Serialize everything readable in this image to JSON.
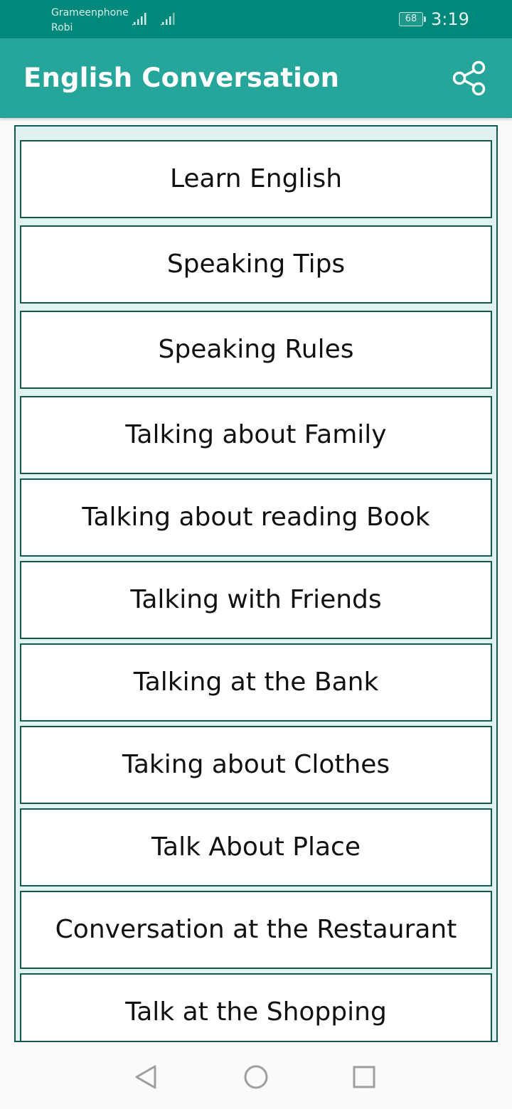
{
  "status_bar": {
    "carrier_1": "Grameenphone",
    "carrier_2": "Robi",
    "battery": "68",
    "time": "3:19"
  },
  "app_bar": {
    "title": "English Conversation",
    "share_icon": "share-icon"
  },
  "menu": {
    "items": [
      "Learn English",
      "Speaking Tips",
      "Speaking Rules",
      "Talking about Family",
      "Talking about reading Book",
      "Talking with Friends",
      "Talking at the Bank",
      "Taking about Clothes",
      "Talk About Place",
      "Conversation at the Restaurant",
      "Talk at the Shopping"
    ]
  },
  "nav_bar": {
    "icons": [
      "back-icon",
      "home-icon",
      "recents-icon"
    ]
  },
  "colors": {
    "status_bar": "#00897b",
    "app_bar": "#26a69a",
    "item_border": "#0e5a4e",
    "list_background": "#e0f2ef"
  }
}
